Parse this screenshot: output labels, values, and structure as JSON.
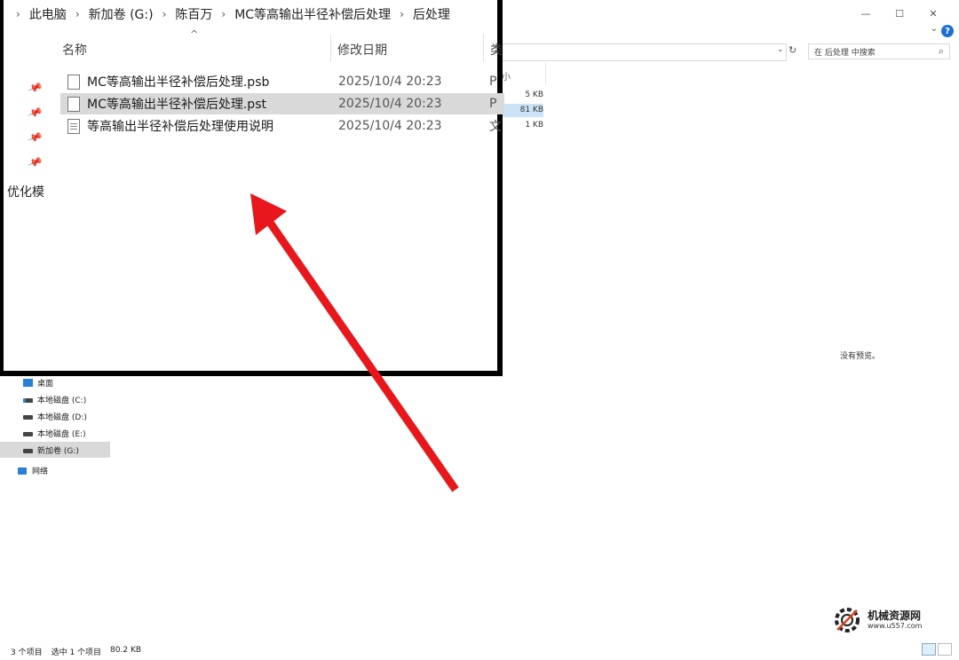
{
  "window": {
    "minimize": "—",
    "maximize": "☐",
    "close": "✕",
    "help": "?"
  },
  "search": {
    "placeholder": "在 后处理 中搜索"
  },
  "columns": {
    "name": "名称",
    "date": "修改日期",
    "type": "类",
    "size": "小"
  },
  "breadcrumb": [
    "此电脑",
    "新加卷 (G:)",
    "陈百万",
    "MC等高输出半径补偿后处理",
    "后处理"
  ],
  "files": [
    {
      "name": "MC等高输出半径补偿后处理.psb",
      "date": "2025/10/4 20:23",
      "type": "P",
      "size": "5 KB"
    },
    {
      "name": "MC等高输出半径补偿后处理.pst",
      "date": "2025/10/4 20:23",
      "type": "P",
      "size": "81 KB"
    },
    {
      "name": "等高输出半径补偿后处理使用说明",
      "date": "2025/10/4 20:23",
      "type": "文",
      "size": "1 KB"
    }
  ],
  "left_cut_text": "优化模",
  "preview": {
    "empty_text": "没有预览。"
  },
  "nav": {
    "desktop": "桌面",
    "drives": [
      "本地磁盘 (C:)",
      "本地磁盘 (D:)",
      "本地磁盘 (E:)",
      "新加卷 (G:)"
    ],
    "network": "网络"
  },
  "status": {
    "count": "3 个项目",
    "selected": "选中 1 个项目",
    "size": "80.2 KB"
  },
  "watermark": {
    "title": "机械资源网",
    "url": "www.u557.com"
  },
  "colors": {
    "arrow": "#e8171c",
    "frame": "#000000",
    "selection": "#d9d9d9",
    "help": "#1a6fd1"
  }
}
